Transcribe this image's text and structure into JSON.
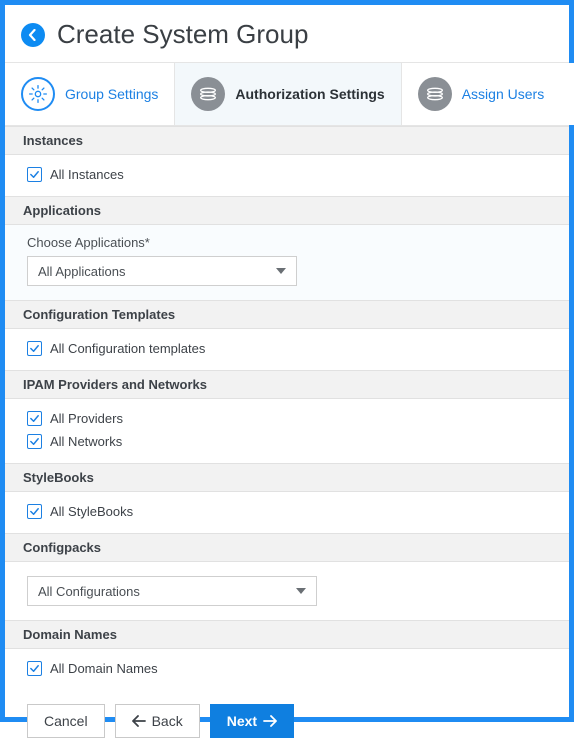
{
  "header": {
    "title": "Create System Group"
  },
  "tabs": [
    {
      "id": "group-settings",
      "label": "Group Settings",
      "active": false,
      "style": "blue"
    },
    {
      "id": "authorization-settings",
      "label": "Authorization Settings",
      "active": true,
      "style": "dark"
    },
    {
      "id": "assign-users",
      "label": "Assign Users",
      "active": false,
      "style": "blue"
    }
  ],
  "sections": {
    "instances": {
      "header": "Instances",
      "checkbox_all": "All Instances"
    },
    "applications": {
      "header": "Applications",
      "choose_label": "Choose Applications*",
      "select_value": "All Applications"
    },
    "config_templates": {
      "header": "Configuration Templates",
      "checkbox_all": "All Configuration templates"
    },
    "ipam": {
      "header": "IPAM Providers and Networks",
      "checkbox_providers": "All Providers",
      "checkbox_networks": "All Networks"
    },
    "stylebooks": {
      "header": "StyleBooks",
      "checkbox_all": "All StyleBooks"
    },
    "configpacks": {
      "header": "Configpacks",
      "select_value": "All Configurations"
    },
    "domain_names": {
      "header": "Domain Names",
      "checkbox_all": "All Domain Names"
    }
  },
  "footer": {
    "cancel": "Cancel",
    "back": "Back",
    "next": "Next"
  }
}
